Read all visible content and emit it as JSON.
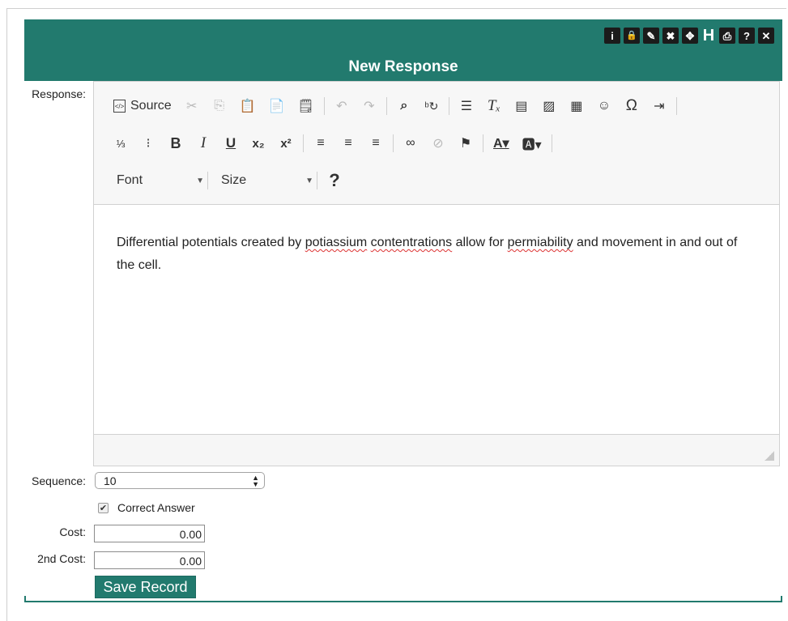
{
  "dialog": {
    "title": "New Response",
    "title_icons": [
      "info-icon",
      "lock-icon",
      "pencil-icon",
      "clear-icon",
      "move-icon",
      "heading-icon",
      "print-icon",
      "help-icon",
      "close-icon"
    ],
    "title_icon_glyphs": [
      "i",
      "🔒",
      "✎",
      "✖",
      "✥",
      "H",
      "⎙",
      "?",
      "✕"
    ]
  },
  "labels": {
    "response": "Response:",
    "sequence": "Sequence:",
    "cost": "Cost:",
    "second_cost": "2nd Cost:"
  },
  "editor": {
    "toolbar": {
      "source_label": "Source",
      "font_label": "Font",
      "size_label": "Size",
      "row1": [
        "source",
        "cut-icon",
        "copy-icon",
        "paste-icon",
        "paste-text-icon",
        "paste-word-icon",
        "undo-icon",
        "redo-icon",
        "find-icon",
        "replace-icon",
        "select-all-icon",
        "remove-format-icon",
        "iframe-icon",
        "image-icon",
        "table-icon",
        "smiley-icon",
        "special-char-icon",
        "indent-icon"
      ],
      "row2": [
        "numbered-list-icon",
        "bulleted-list-icon",
        "bold-icon",
        "italic-icon",
        "underline-icon",
        "subscript-icon",
        "superscript-icon",
        "align-left-icon",
        "align-center-icon",
        "align-right-icon",
        "link-icon",
        "unlink-icon",
        "anchor-icon",
        "text-color-icon",
        "bg-color-icon"
      ],
      "row3": [
        "font-combo",
        "size-combo",
        "help-icon"
      ]
    },
    "content": {
      "segments": [
        {
          "text": "Differential potentials created by ",
          "misspelled": false
        },
        {
          "text": "potiassium",
          "misspelled": true
        },
        {
          "text": " ",
          "misspelled": false
        },
        {
          "text": "contentrations",
          "misspelled": true
        },
        {
          "text": " allow for ",
          "misspelled": false
        },
        {
          "text": "permiability",
          "misspelled": true
        },
        {
          "text": " and movement in and out of the cell.",
          "misspelled": false
        }
      ]
    }
  },
  "form": {
    "sequence_value": "10",
    "correct_answer_label": "Correct Answer",
    "correct_answer_checked": true,
    "cost_value": "0.00",
    "second_cost_value": "0.00",
    "save_label": "Save Record"
  },
  "colors": {
    "accent": "#227a6e",
    "misspell_underline": "#dd3333"
  }
}
